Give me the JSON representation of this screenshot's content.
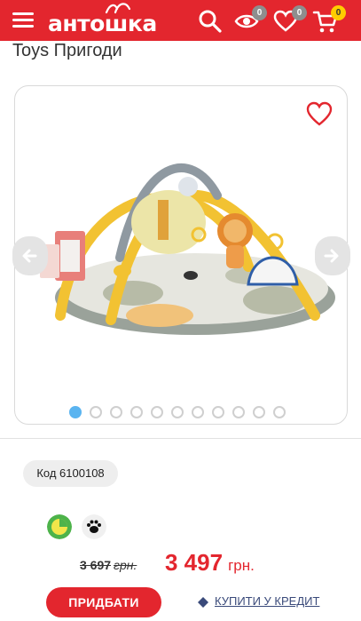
{
  "header": {
    "logo_text": "антошка",
    "views_count": "0",
    "wishlist_count": "0",
    "cart_count": "0",
    "colors": {
      "bar": "#e3262e",
      "cart_badge": "#ffcc00",
      "badge": "#8e8e8e"
    },
    "icons": [
      "menu-icon",
      "search-icon",
      "eye-icon",
      "heart-icon",
      "cart-icon"
    ]
  },
  "product": {
    "brand_title": "Toys Пригоди",
    "gallery": {
      "image": "play-gym-mat-photo",
      "total_slides": 11,
      "active_slide": 1,
      "icons": [
        "arrow-left-icon",
        "arrow-right-icon",
        "favorite-heart-icon"
      ]
    },
    "code_label": "Код 6100108",
    "feature_icons": [
      "eco-pie-icon",
      "paw-icon"
    ],
    "old_price": "3 697",
    "old_currency": "грн.",
    "new_price": "3 497",
    "new_currency": "грн.",
    "add_button": "ПРИДБАТИ",
    "credit_link": "КУПИТИ У КРЕДИТ",
    "accent_color": "#e3262e"
  }
}
